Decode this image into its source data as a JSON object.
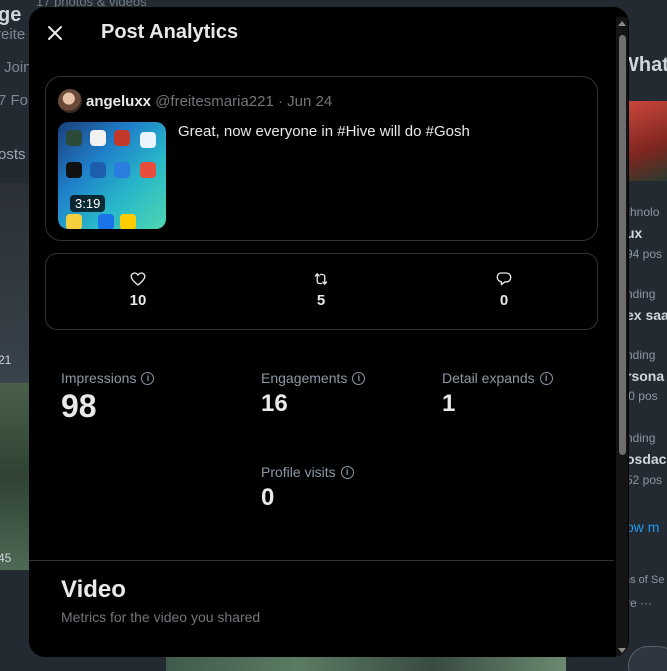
{
  "background": {
    "top_text": "17 photos & videos",
    "left_fragments": [
      "ge",
      "reite",
      "Join",
      "7 Fol",
      "osts",
      "21",
      "45"
    ],
    "right_fragments": [
      "What",
      "chnolo",
      "ux",
      "94 pos",
      "nding",
      "ex saa",
      "nding",
      "rsona",
      "'0 pos",
      "nding",
      "osdac",
      "52 pos",
      "ow m",
      "ns of Se",
      "re ···"
    ]
  },
  "modal": {
    "title": "Post Analytics",
    "close_icon": "close-icon"
  },
  "post": {
    "author": "angeluxx",
    "handle": "@freitesmaria221",
    "separator": "·",
    "date": "Jun 24",
    "text": "Great, now everyone in #Hive will do #Gosh",
    "video_duration": "3:19"
  },
  "stats": {
    "likes": {
      "icon": "heart-icon",
      "value": "10"
    },
    "reposts": {
      "icon": "repost-icon",
      "value": "5"
    },
    "replies": {
      "icon": "reply-icon",
      "value": "0"
    }
  },
  "metrics": {
    "impressions": {
      "label": "Impressions",
      "value": "98"
    },
    "engagements": {
      "label": "Engagements",
      "value": "16"
    },
    "detail_expands": {
      "label": "Detail expands",
      "value": "1"
    },
    "profile_visits": {
      "label": "Profile visits",
      "value": "0"
    }
  },
  "video_section": {
    "title": "Video",
    "subtitle": "Metrics for the video you shared"
  },
  "colors": {
    "modal_bg": "#000000",
    "border": "#2f3336",
    "text_primary": "#e7e9ea",
    "text_secondary": "#71767b"
  }
}
